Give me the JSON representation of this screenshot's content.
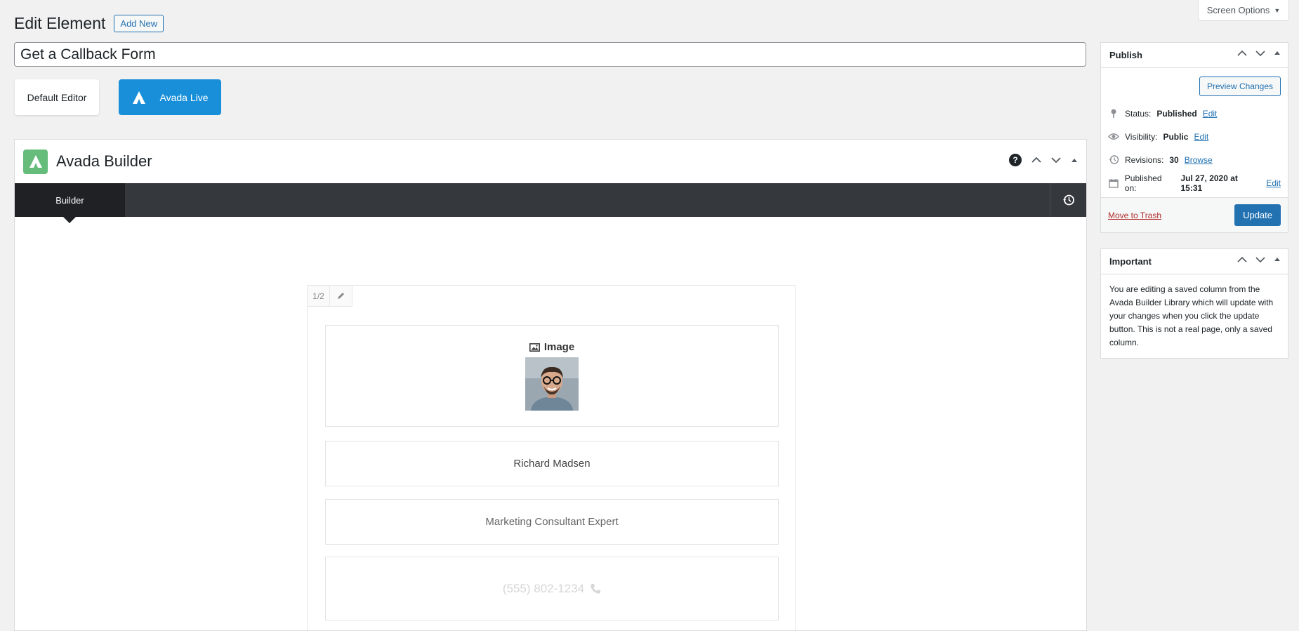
{
  "screen_options": {
    "label": "Screen Options"
  },
  "header": {
    "title": "Edit Element",
    "add_new": "Add New"
  },
  "post_title": {
    "value": "Get a Callback Form"
  },
  "editor_buttons": {
    "default": "Default Editor",
    "live": "Avada Live"
  },
  "builder": {
    "title": "Avada Builder",
    "help": "?",
    "tab": "Builder",
    "column": {
      "size": "1/2",
      "image_label": "Image",
      "name": "Richard Madsen",
      "role": "Marketing Consultant Expert",
      "phone": "(555) 802-1234"
    }
  },
  "publish": {
    "title": "Publish",
    "preview": "Preview Changes",
    "status_label": "Status:",
    "status_value": "Published",
    "visibility_label": "Visibility:",
    "visibility_value": "Public",
    "revisions_label": "Revisions:",
    "revisions_value": "30",
    "browse": "Browse",
    "published_label": "Published on:",
    "published_value": "Jul 27, 2020 at 15:31",
    "edit": "Edit",
    "trash": "Move to Trash",
    "update": "Update"
  },
  "important": {
    "title": "Important",
    "text": "You are editing a saved column from the Avada Builder Library which will update with your changes when you click the update button. This is not a real page, only a saved column."
  },
  "colors": {
    "accent": "#2271b1",
    "avada_live": "#198fd9",
    "avada_green": "#65bc7b",
    "dark_bar": "#35393e"
  }
}
